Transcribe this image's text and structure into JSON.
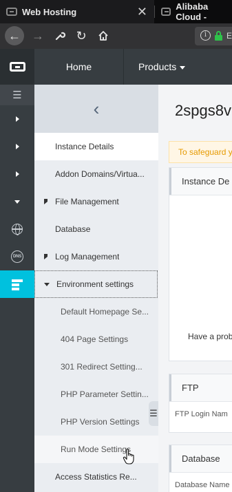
{
  "browser": {
    "tabs": [
      {
        "title": "Web Hosting",
        "close": "✕"
      },
      {
        "title": "Alibaba Cloud -"
      }
    ],
    "url_visible": "E"
  },
  "header": {
    "nav": [
      {
        "label": "Home"
      },
      {
        "label": "Products"
      }
    ]
  },
  "rail": {
    "items": [
      "menu-icon",
      "expand-icon",
      "expand-icon",
      "expand-icon",
      "collapse-icon",
      "globe-icon",
      "dns-icon",
      "server-icon"
    ],
    "dns_text": "DNS",
    "active_color": "#00c1de"
  },
  "sidebar": {
    "collapse_glyph": "‹",
    "items": [
      {
        "label": "Instance Details",
        "state": "selected"
      },
      {
        "label": "Addon Domains/Virtua..."
      },
      {
        "label": "File Management",
        "expandable": true,
        "expanded": false
      },
      {
        "label": "Database"
      },
      {
        "label": "Log Management",
        "expandable": true,
        "expanded": false
      },
      {
        "label": "Environment settings",
        "expandable": true,
        "expanded": true,
        "state": "focused"
      },
      {
        "label": "Default Homepage Se...",
        "level": 2
      },
      {
        "label": "404 Page Settings",
        "level": 2
      },
      {
        "label": "301 Redirect Setting...",
        "level": 2
      },
      {
        "label": "PHP Parameter Settin...",
        "level": 2
      },
      {
        "label": "PHP Version Settings",
        "level": 2
      },
      {
        "label": "Run Mode Settings",
        "level": 2,
        "state": "hover"
      },
      {
        "label": "Access Statistics Re..."
      }
    ]
  },
  "main": {
    "instance_title": "2spgs8v",
    "notice": "To safeguard y",
    "panels": {
      "instance": {
        "title": "Instance De",
        "problem_text": "Have a prob"
      },
      "ftp": {
        "title": "FTP",
        "field_label": "FTP Login Nam"
      },
      "database": {
        "title": "Database",
        "field_label": "Database Name"
      }
    }
  }
}
